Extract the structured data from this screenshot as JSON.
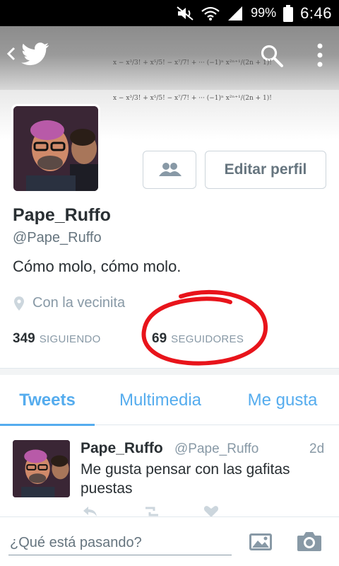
{
  "status_bar": {
    "battery_percent": "99%",
    "time": "6:46"
  },
  "header": {
    "formula": "x − x³/3! + x⁵/5! − x⁷/7! + ··· (−1)ⁿ x²ⁿ⁺¹/(2n + 1)!",
    "formula_repeat": "x − x³/3! + x⁵/5! − x⁷/7! + ··· (−1)ⁿ x²ⁿ⁺¹/(2n + 1)!"
  },
  "profile": {
    "edit_label": "Editar perfil",
    "name": "Pape_Ruffo",
    "handle": "@Pape_Ruffo",
    "bio": "Cómo molo, cómo molo.",
    "location": "Con la vecinita",
    "following_count": "349",
    "following_label": "SIGUIENDO",
    "followers_count": "69",
    "followers_label": "SEGUIDORES"
  },
  "tabs": [
    {
      "label": "Tweets",
      "active": true
    },
    {
      "label": "Multimedia",
      "active": false
    },
    {
      "label": "Me gusta",
      "active": false
    }
  ],
  "tweet": {
    "name": "Pape_Ruffo",
    "handle": "@Pape_Ruffo",
    "time": "2d",
    "text": "Me gusta pensar con las gafitas puestas"
  },
  "compose": {
    "placeholder": "¿Qué está pasando?"
  },
  "colors": {
    "accent": "#55acee",
    "annotation": "#e8141b"
  },
  "icons": [
    "back-chevron-icon",
    "twitter-bird-icon",
    "search-icon",
    "overflow-menu-icon",
    "follow-people-icon",
    "location-pin-icon",
    "reply-icon",
    "retweet-icon",
    "like-icon",
    "photo-icon",
    "camera-icon"
  ]
}
